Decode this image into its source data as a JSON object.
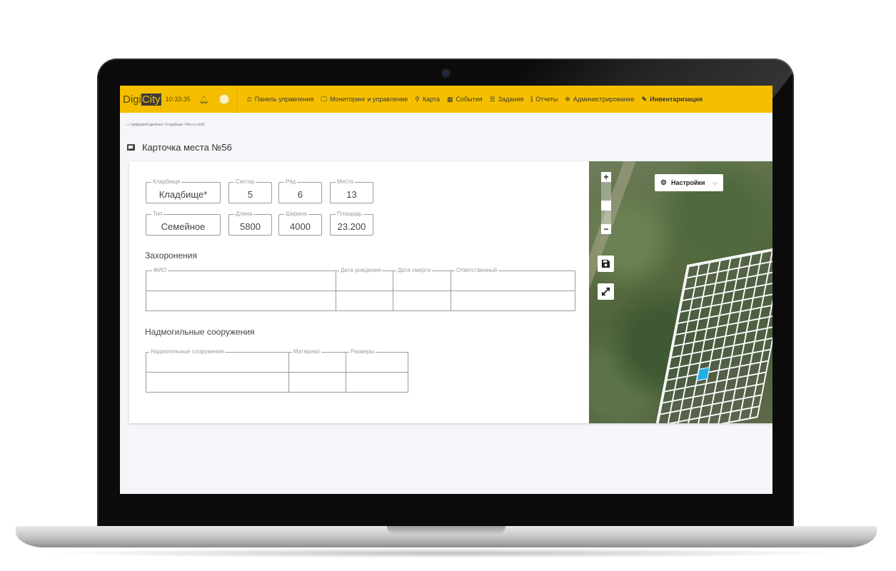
{
  "app": {
    "logo_part1": "Digi",
    "logo_part2": "City",
    "clock": "10:33:35"
  },
  "nav": {
    "items": [
      {
        "icon": "⏲",
        "label": "Панель управления"
      },
      {
        "icon": "🖵",
        "label": "Мониторинг и управление"
      },
      {
        "icon": "⚲",
        "label": "Карта"
      },
      {
        "icon": "▦",
        "label": "События"
      },
      {
        "icon": "☰",
        "label": "Задания"
      },
      {
        "icon": "⫿",
        "label": "Отчеты"
      },
      {
        "icon": "✲",
        "label": "Администрирование"
      },
      {
        "icon": "✎",
        "label": "Инвентаризация"
      }
    ]
  },
  "breadcrumb": "⌂ / Цифровой двойник / Кладбище / Место №56",
  "page": {
    "title": "Карточка места №56"
  },
  "fields": {
    "cemetery": {
      "label": "Кладбище",
      "value": "Кладбище*"
    },
    "sector": {
      "label": "Сектор",
      "value": "5"
    },
    "row": {
      "label": "Ряд",
      "value": "6"
    },
    "place": {
      "label": "Место",
      "value": "13"
    },
    "type": {
      "label": "Тип",
      "value": "Семейное"
    },
    "length": {
      "label": "Длина",
      "value": "5800"
    },
    "width": {
      "label": "Ширина",
      "value": "4000"
    },
    "area": {
      "label": "Площадь",
      "value": "23.200"
    }
  },
  "burials": {
    "title": "Захоронения",
    "columns": [
      "ФИО",
      "Дата рождения",
      "Дата смерти",
      "Ответственный"
    ]
  },
  "monuments": {
    "title": "Надмогильные сооружения",
    "columns": [
      "Надмогильные сооружения",
      "Материал",
      "Размеры"
    ]
  },
  "map": {
    "zoom_in": "+",
    "zoom_out": "−",
    "settings_label": "Настройки"
  },
  "colors": {
    "accent": "#f5bf00",
    "selected_plot": "#1fb0e6"
  }
}
